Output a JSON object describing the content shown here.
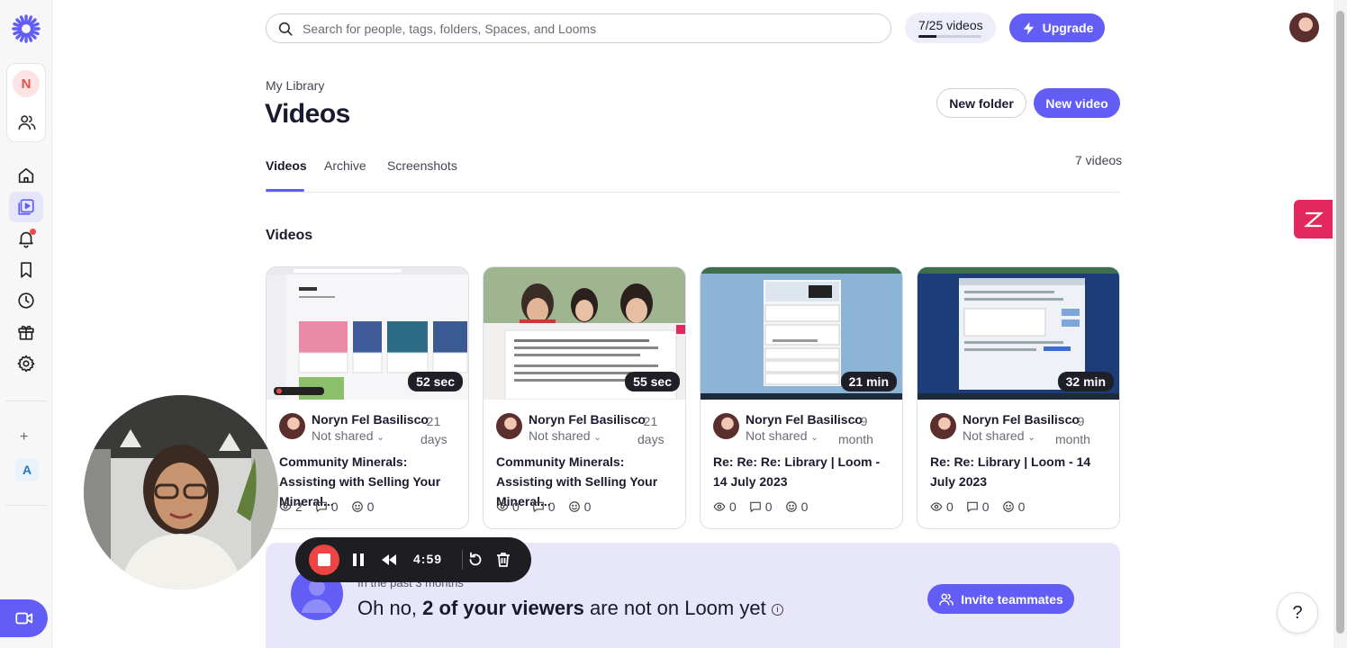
{
  "search": {
    "placeholder": "Search for people, tags, folders, Spaces, and Looms"
  },
  "quota": {
    "label": "7/25 videos",
    "used": 7,
    "limit": 25
  },
  "upgrade": {
    "label": "Upgrade"
  },
  "sidebar": {
    "workspace_initial": "N",
    "secondary_initial": "A",
    "add_label": "+",
    "items": [
      {
        "icon": "home-icon"
      },
      {
        "icon": "library-icon",
        "active": true
      },
      {
        "icon": "bell-icon",
        "has_notification": true
      },
      {
        "icon": "bookmark-icon"
      },
      {
        "icon": "clock-icon"
      },
      {
        "icon": "gift-icon"
      },
      {
        "icon": "gear-icon"
      }
    ]
  },
  "header": {
    "breadcrumb": "My Library",
    "title": "Videos",
    "new_folder_label": "New folder",
    "new_video_label": "New video"
  },
  "tabs": [
    {
      "label": "Videos",
      "active": true
    },
    {
      "label": "Archive"
    },
    {
      "label": "Screenshots"
    }
  ],
  "video_count": "7 videos",
  "section_title": "Videos",
  "videos": [
    {
      "duration": "52 sec",
      "author": "Noryn Fel Basilisco",
      "time_value": "21",
      "time_unit": "days",
      "share": "Not shared",
      "title": "Community Minerals: Assisting with Selling Your Mineral...",
      "views": "2",
      "comments": "0",
      "reactions": "0"
    },
    {
      "duration": "55 sec",
      "author": "Noryn Fel Basilisco",
      "time_value": "21",
      "time_unit": "days",
      "share": "Not shared",
      "title": "Community Minerals: Assisting with Selling Your Mineral...",
      "views": "0",
      "comments": "0",
      "reactions": "0"
    },
    {
      "duration": "21 min",
      "author": "Noryn Fel Basilisco",
      "time_value": "9",
      "time_unit": "month",
      "share": "Not shared",
      "title": "Re: Re: Re: Library | Loom - 14 July 2023",
      "views": "0",
      "comments": "0",
      "reactions": "0"
    },
    {
      "duration": "32 min",
      "author": "Noryn Fel Basilisco",
      "time_value": "9",
      "time_unit": "month",
      "share": "Not shared",
      "title": "Re: Re: Library | Loom - 14 July 2023",
      "views": "0",
      "comments": "0",
      "reactions": "0"
    }
  ],
  "recording": {
    "elapsed": "4:59"
  },
  "banner": {
    "period": "In the past 3 months",
    "text_prefix": "Oh no, ",
    "text_bold": "2 of your viewers",
    "text_suffix": " are not on Loom yet",
    "invite_label": "Invite teammates"
  },
  "help": {
    "label": "?"
  },
  "colors": {
    "accent": "#625df5",
    "record_red": "#ef4444",
    "banner_bg": "#e8e6fb"
  }
}
